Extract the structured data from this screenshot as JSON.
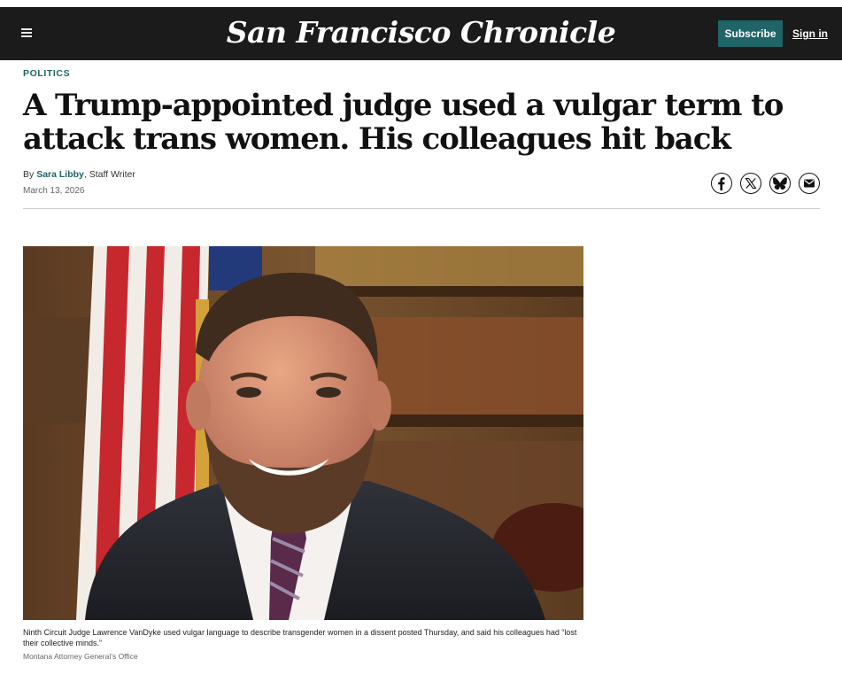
{
  "header": {
    "logo_text": "San Francisco Chronicle",
    "subscribe_label": "Subscribe",
    "signin_label": "Sign in",
    "menu_icon": "hamburger-menu-icon"
  },
  "article": {
    "section": "POLITICS",
    "headline": "A Trump-appointed judge used a vulgar term to attack trans women. His colleagues hit back",
    "byline_prefix": "By",
    "author": "Sara Libby",
    "author_role": "Staff Writer",
    "date": "March 13, 2026"
  },
  "share": [
    {
      "icon": "facebook-icon"
    },
    {
      "icon": "x-icon"
    },
    {
      "icon": "bluesky-icon"
    },
    {
      "icon": "email-icon"
    }
  ],
  "photo": {
    "caption": "Ninth Circuit Judge Lawrence VanDyke used vulgar language to describe transgender women in a dissent posted Thursday, and said his colleagues had “lost their collective minds.”",
    "credit": "Montana Attorney General’s Office"
  },
  "colors": {
    "accent": "#1f6467",
    "header_bg": "#1b1b1b"
  }
}
